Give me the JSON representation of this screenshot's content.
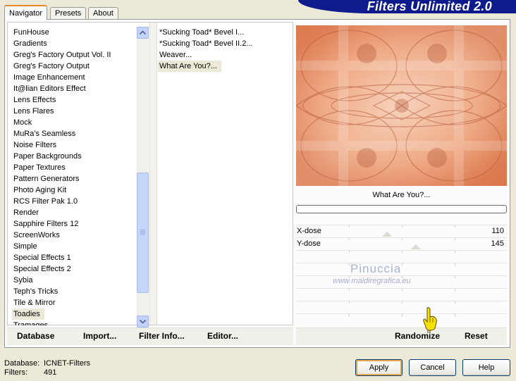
{
  "window": {
    "title": "Filters Unlimited 2.0"
  },
  "tabs": [
    {
      "label": "Navigator",
      "active": true
    },
    {
      "label": "Presets",
      "active": false
    },
    {
      "label": "About",
      "active": false
    }
  ],
  "categories": [
    "FunHouse",
    "Gradients",
    "Greg's Factory Output Vol. II",
    "Greg's Factory Output",
    "Image Enhancement",
    "It@lian Editors Effect",
    "Lens Effects",
    "Lens Flares",
    "Mock",
    "MuRa's Seamless",
    "Noise Filters",
    "Paper Backgrounds",
    "Paper Textures",
    "Pattern Generators",
    "Photo Aging Kit",
    "RCS Filter Pak 1.0",
    "Render",
    "Sapphire Filters 12",
    "ScreenWorks",
    "Simple",
    "Special Effects 1",
    "Special Effects 2",
    "Sybia",
    "Teph's Tricks",
    "Tile & Mirror",
    "Toadies",
    "Tramages"
  ],
  "selected_category": "Toadies",
  "filters": [
    "*Sucking Toad*  Bevel I...",
    "*Sucking Toad*  Bevel II.2...",
    "Weaver...",
    "What Are You?..."
  ],
  "selected_filter": "What Are You?...",
  "preview": {
    "filter_name": "What Are You?...",
    "progress": 0
  },
  "sliders": [
    {
      "label": "X-dose",
      "value": "110",
      "level": 110
    },
    {
      "label": "Y-dose",
      "value": "145",
      "level": 145
    }
  ],
  "watermark": {
    "name": "Pinuccia",
    "url": "www.maidiregrafica.eu"
  },
  "toolbar": {
    "database": "Database",
    "import": "Import...",
    "filter_info": "Filter Info...",
    "editor": "Editor...",
    "randomize": "Randomize",
    "reset": "Reset"
  },
  "status": {
    "database_label": "Database:",
    "database_value": "ICNET-Filters",
    "filters_label": "Filters:",
    "filters_value": "491"
  },
  "buttons": {
    "apply": "Apply",
    "cancel": "Cancel",
    "help": "Help"
  },
  "colors": {
    "banner": "#0d1b8c",
    "tab_highlight": "#e68b2c",
    "preview_tint": "#f0b08c"
  }
}
